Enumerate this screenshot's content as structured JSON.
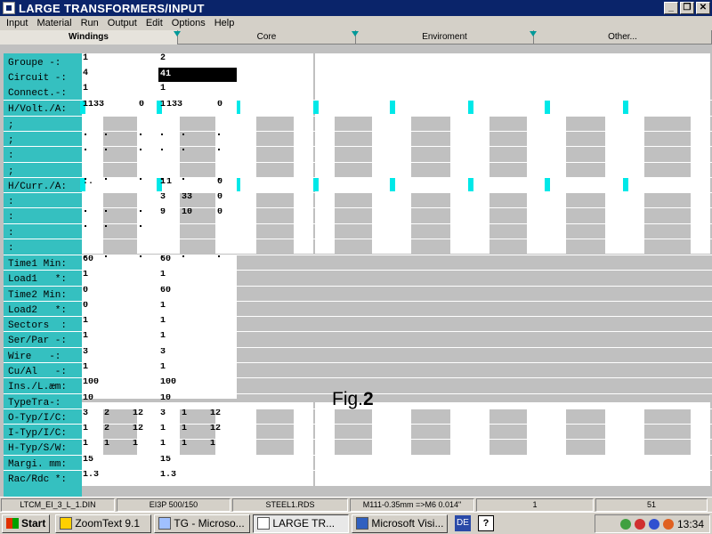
{
  "window": {
    "title": "LARGE TRANSFORMERS/INPUT"
  },
  "title_buttons": {
    "minimize": "_",
    "restore": "❐",
    "close": "✕"
  },
  "menu": [
    "Input",
    "Material",
    "Run",
    "Output",
    "Edit",
    "Options",
    "Help"
  ],
  "tabs": [
    "Windings",
    "Core",
    "Enviroment",
    "Other..."
  ],
  "labels": [
    "Groupe -:",
    "Circuit -:",
    "Connect.-:",
    "H/Volt./A:",
    ";",
    ";",
    ":",
    ";",
    "H/Curr./A:",
    ":",
    ":",
    ":",
    ":",
    "Time1 Min:",
    "Load1   *:",
    "Time2 Min:",
    "Load2   *:",
    "Sectors  :",
    "Ser/Par -:",
    "Wire   -:",
    "Cu/Al   -:",
    "Ins./L.æm:",
    "TypeTra-:",
    "O-Typ/I/C:",
    "I-Typ/I/C:",
    "H-Typ/S/W:",
    "Margi. mm:",
    "Rac/Rdc *:"
  ],
  "col1": {
    "groupe": "1",
    "circuit": "4",
    "connect": "1",
    "hvolt": [
      "1",
      "133",
      "0"
    ],
    "hcurr": [
      ".",
      "."
    ],
    "time1": "60",
    "load1": "1",
    "time2": "0",
    "load2": "0",
    "sectors": "1",
    "serpar": "1",
    "wire": "3",
    "cual": "1",
    "ins": "100",
    "typetra": "10",
    "otyp": [
      "3",
      "2",
      "12"
    ],
    "ityp": [
      "1",
      "2",
      "12"
    ],
    "htyp": [
      "1",
      "1",
      "1"
    ],
    "margi": "15",
    "racrdc": "1.3"
  },
  "col2": {
    "groupe": "2",
    "circuit": "41",
    "connect": "1",
    "hvolt": [
      "1",
      "133",
      "0"
    ],
    "hcurr": [
      "1",
      "1",
      "0"
    ],
    "hcurr2": [
      "3",
      "33",
      "0"
    ],
    "hcurr3": [
      "9",
      "10",
      "0"
    ],
    "time1": "60",
    "load1": "1",
    "time2": "60",
    "load2": "1",
    "sectors": "1",
    "serpar": "1",
    "wire": "3",
    "cual": "1",
    "ins": "100",
    "typetra": "10",
    "otyp": [
      "3",
      "1",
      "12"
    ],
    "ityp": [
      "1",
      "1",
      "12"
    ],
    "htyp": [
      "1",
      "1",
      "1"
    ],
    "margi": "15",
    "racrdc": "1.3"
  },
  "figure": {
    "prefix": "Fig.",
    "number": "2"
  },
  "status": [
    "LTCM_EI_3_L_1.DIN",
    "EI3P 500/150",
    "STEEL1.RDS",
    "M111-0.35mm =>M6 0.014\"",
    "1",
    "51"
  ],
  "taskbar": {
    "start": "Start",
    "tasks": [
      "ZoomText 9.1",
      "TG - Microso...",
      "LARGE TR...",
      "Microsoft Visi..."
    ],
    "lang": "DE",
    "help": "?",
    "time": "13:34"
  },
  "colors": {
    "label_bg": "#35c0c0",
    "cyan_marker": "#00e8e8",
    "title_bg": "#0a246a"
  }
}
